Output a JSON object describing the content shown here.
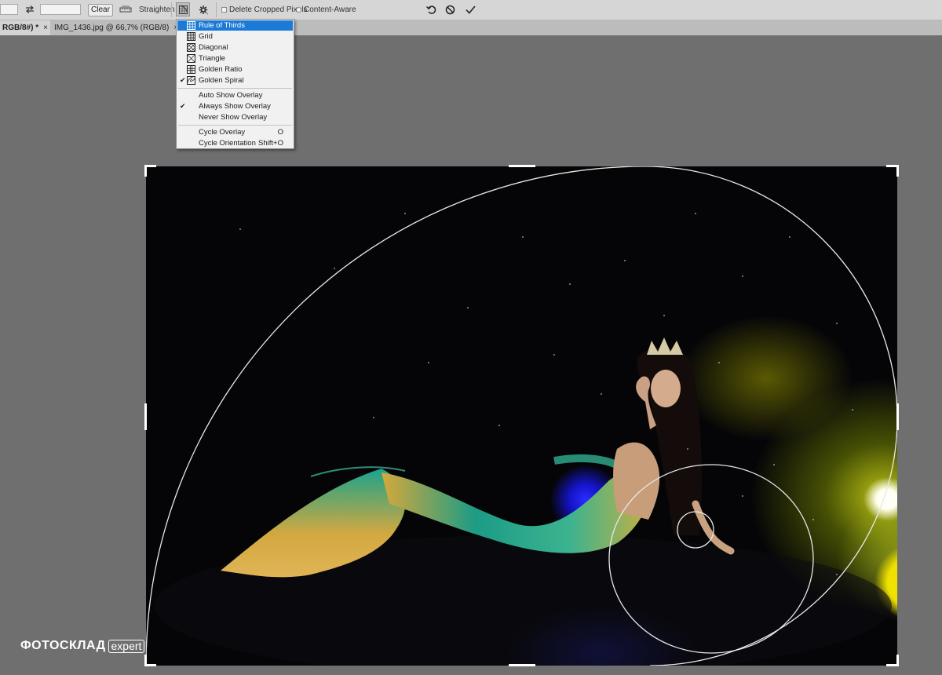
{
  "toolbar": {
    "clear_label": "Clear",
    "straighten_label": "Straighten",
    "delete_cropped_label": "Delete Cropped Pixels",
    "content_aware_label": "Content-Aware",
    "overlay_icon": "crop-overlay-icon",
    "settings_icon": "gear-icon",
    "reset_icon": "undo-icon",
    "cancel_icon": "cancel-icon",
    "commit_icon": "checkmark-icon"
  },
  "tabs": [
    {
      "label": "RGB/8#) *",
      "close": "×"
    },
    {
      "label": "IMG_1436.jpg @ 66,7% (RGB/8)",
      "close": "×"
    }
  ],
  "menu": {
    "overlays": [
      {
        "label": "Rule of Thirds",
        "highlighted": true,
        "checked": false
      },
      {
        "label": "Grid",
        "highlighted": false,
        "checked": false
      },
      {
        "label": "Diagonal",
        "highlighted": false,
        "checked": false
      },
      {
        "label": "Triangle",
        "highlighted": false,
        "checked": false
      },
      {
        "label": "Golden Ratio",
        "highlighted": false,
        "checked": false
      },
      {
        "label": "Golden Spiral",
        "highlighted": false,
        "checked": true
      }
    ],
    "show_options": [
      {
        "label": "Auto Show Overlay",
        "checked": false
      },
      {
        "label": "Always Show Overlay",
        "checked": true
      },
      {
        "label": "Never Show Overlay",
        "checked": false
      }
    ],
    "cycle": [
      {
        "label": "Cycle Overlay",
        "shortcut": "O"
      },
      {
        "label": "Cycle Orientation",
        "shortcut": "Shift+O"
      }
    ],
    "check_glyph": "✔"
  },
  "watermark": {
    "brand": "ФОТОСКЛАД",
    "suffix": "expert"
  },
  "colors": {
    "highlight": "#1b7ad6",
    "canvas": "#6f6f6f",
    "toolbar": "#d6d6d6"
  }
}
